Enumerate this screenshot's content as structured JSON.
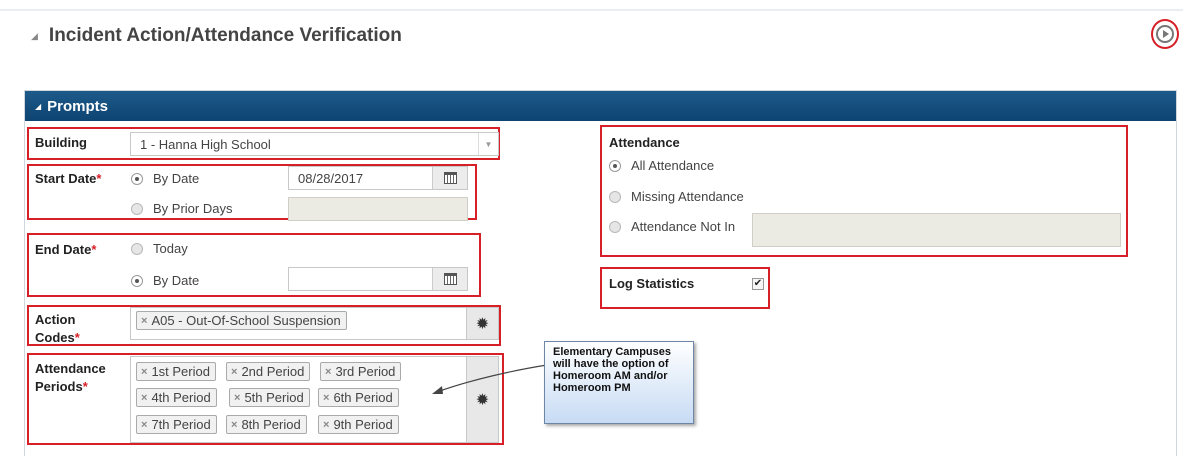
{
  "header": {
    "title": "Incident Action/Attendance Verification"
  },
  "prompts": {
    "title": "Prompts",
    "building": {
      "label": "Building",
      "value": "1 - Hanna High School"
    },
    "start_date": {
      "label": "Start Date",
      "required_mark": "*",
      "option_by_date": "By Date",
      "option_by_prior_days": "By Prior Days",
      "selected": "By Date",
      "date_value": "08/28/2017"
    },
    "end_date": {
      "label": "End Date",
      "required_mark": "*",
      "option_today": "Today",
      "option_by_date": "By Date",
      "selected": "By Date",
      "date_value": ""
    },
    "action_codes": {
      "label_line1": "Action",
      "label_line2": "Codes",
      "required_mark": "*",
      "tags": [
        "A05 - Out-Of-School Suspension"
      ],
      "select_symbol": "✹"
    },
    "attendance_periods": {
      "label_line1": "Attendance",
      "label_line2": "Periods",
      "required_mark": "*",
      "tags": [
        "1st Period",
        "2nd Period",
        "3rd Period",
        "4th Period",
        "5th Period",
        "6th Period",
        "7th Period",
        "8th Period",
        "9th Period"
      ],
      "select_symbol": "✹"
    },
    "attendance": {
      "label": "Attendance",
      "options": [
        "All Attendance",
        "Missing Attendance",
        "Attendance Not In"
      ],
      "selected": "All Attendance"
    },
    "log_statistics": {
      "label": "Log Statistics",
      "checked": true,
      "check_glyph": "✔"
    }
  },
  "callout": {
    "text_lines": [
      "Elementary Campuses",
      "will have the option of",
      "Homeroom AM and/or",
      "Homeroom PM"
    ]
  },
  "tag_remove_symbol": "×",
  "colors": {
    "header_bar": "#0d4472",
    "annotation_red": "#d61f26",
    "callout_fill": "#c7dbf4"
  }
}
